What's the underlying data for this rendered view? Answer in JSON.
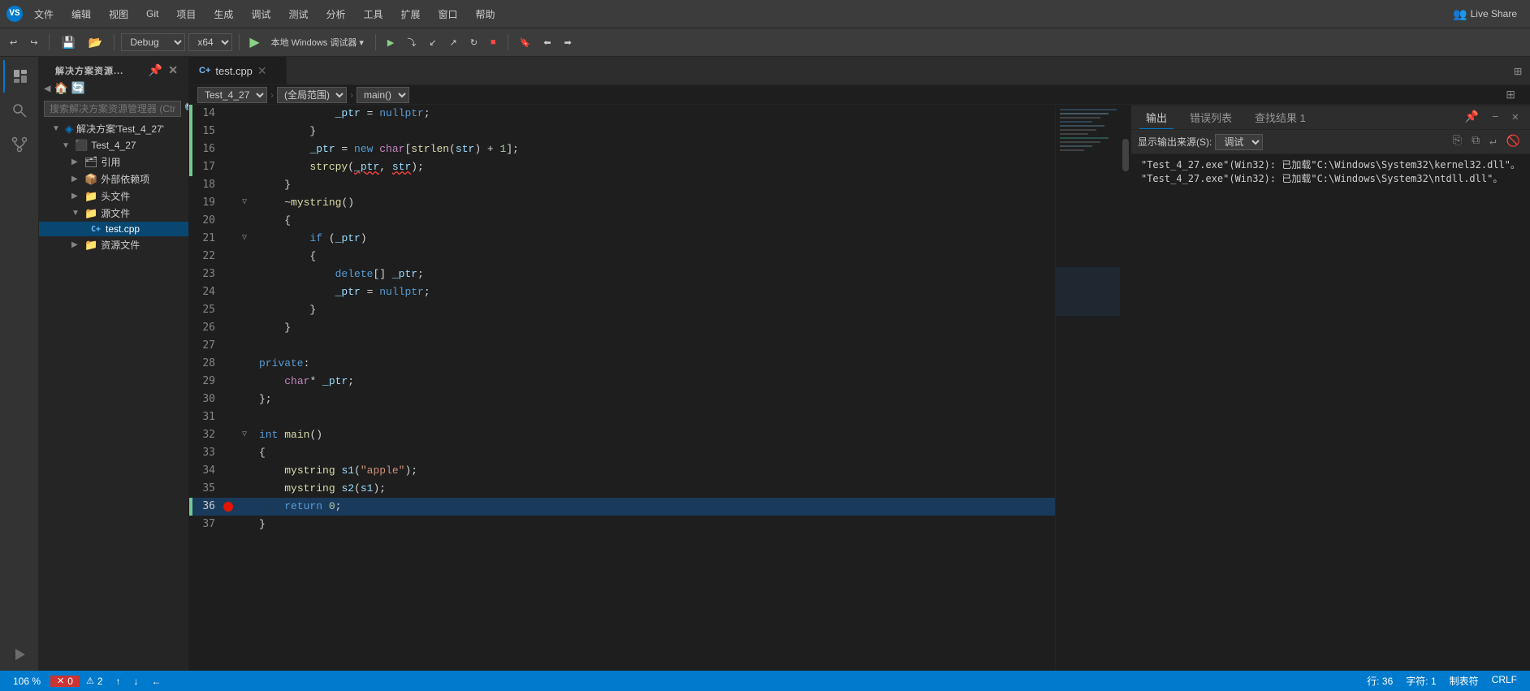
{
  "titlebar": {
    "icon": "VS",
    "menus": [
      "文件",
      "编辑",
      "视图",
      "Git",
      "项目",
      "生成",
      "调试",
      "测试",
      "分析",
      "工具",
      "扩展",
      "窗口",
      "帮助"
    ],
    "live_share_label": "Live Share"
  },
  "toolbar": {
    "undo_label": "↩",
    "redo_label": "↪",
    "config_label": "Debug",
    "arch_label": "x64",
    "play_label": "▶",
    "target_label": "本地 Windows 调试器",
    "run_label": "▶",
    "attach_label": "⏸"
  },
  "sidebar": {
    "title": "解决方案资源...",
    "search_placeholder": "搜索解决方案资源管理器 (Ctrl+;)",
    "tree": [
      {
        "label": "解决方案'Test_4_27'",
        "level": 0,
        "type": "solution",
        "expanded": true
      },
      {
        "label": "Test_4_27",
        "level": 1,
        "type": "project",
        "expanded": true
      },
      {
        "label": "引用",
        "level": 2,
        "type": "folder",
        "expanded": false
      },
      {
        "label": "外部依赖项",
        "level": 2,
        "type": "folder",
        "expanded": false
      },
      {
        "label": "头文件",
        "level": 2,
        "type": "folder",
        "expanded": false
      },
      {
        "label": "源文件",
        "level": 2,
        "type": "folder",
        "expanded": true
      },
      {
        "label": "test.cpp",
        "level": 3,
        "type": "cpp",
        "active": true
      },
      {
        "label": "资源文件",
        "level": 2,
        "type": "folder",
        "expanded": false
      }
    ]
  },
  "tabs": [
    {
      "label": "test.cpp",
      "active": true,
      "modified": false
    }
  ],
  "breadcrumb": {
    "file": "Test_4_27",
    "scope": "(全局范围)",
    "function": "main()"
  },
  "code": {
    "lines": [
      {
        "num": 14,
        "text": "            _ptr = nullptr;",
        "indent": 3,
        "green": true,
        "fold": false
      },
      {
        "num": 15,
        "text": "        }",
        "indent": 2,
        "green": true,
        "fold": false
      },
      {
        "num": 16,
        "text": "        _ptr = new char[strlen(str) + 1];",
        "indent": 2,
        "green": true,
        "fold": false
      },
      {
        "num": 17,
        "text": "        strcpy(_ptr, str);",
        "indent": 2,
        "green": true,
        "fold": false
      },
      {
        "num": 18,
        "text": "    }",
        "indent": 1,
        "green": false,
        "fold": false
      },
      {
        "num": 19,
        "text": "    ~mystring()",
        "indent": 1,
        "green": false,
        "fold": true,
        "folded": false
      },
      {
        "num": 20,
        "text": "    {",
        "indent": 1,
        "green": false,
        "fold": false
      },
      {
        "num": 21,
        "text": "        if (_ptr)",
        "indent": 2,
        "green": false,
        "fold": true,
        "folded": false
      },
      {
        "num": 22,
        "text": "        {",
        "indent": 2,
        "green": false,
        "fold": false
      },
      {
        "num": 23,
        "text": "            delete[] _ptr;",
        "indent": 3,
        "green": false,
        "fold": false
      },
      {
        "num": 24,
        "text": "            _ptr = nullptr;",
        "indent": 3,
        "green": false,
        "fold": false
      },
      {
        "num": 25,
        "text": "        }",
        "indent": 2,
        "green": false,
        "fold": false
      },
      {
        "num": 26,
        "text": "    }",
        "indent": 1,
        "green": false,
        "fold": false
      },
      {
        "num": 27,
        "text": "",
        "indent": 0,
        "green": false,
        "fold": false
      },
      {
        "num": 28,
        "text": "private:",
        "indent": 0,
        "green": false,
        "fold": false
      },
      {
        "num": 29,
        "text": "    char* _ptr;",
        "indent": 1,
        "green": false,
        "fold": false
      },
      {
        "num": 30,
        "text": "};",
        "indent": 0,
        "green": false,
        "fold": false
      },
      {
        "num": 31,
        "text": "",
        "indent": 0,
        "green": false,
        "fold": false
      },
      {
        "num": 32,
        "text": "int main()",
        "indent": 0,
        "green": false,
        "fold": true,
        "folded": false
      },
      {
        "num": 33,
        "text": "{",
        "indent": 0,
        "green": false,
        "fold": false
      },
      {
        "num": 34,
        "text": "    mystring s1(\"apple\");",
        "indent": 1,
        "green": false,
        "fold": false
      },
      {
        "num": 35,
        "text": "    mystring s2(s1);",
        "indent": 1,
        "green": false,
        "fold": false
      },
      {
        "num": 36,
        "text": "    return 0;",
        "indent": 1,
        "green": false,
        "fold": false,
        "current": true,
        "breakpoint": true
      },
      {
        "num": 37,
        "text": "}",
        "indent": 0,
        "green": false,
        "fold": false
      }
    ]
  },
  "statusbar": {
    "errors": "0",
    "warnings": "2",
    "zoom": "106 %",
    "row": "行: 36",
    "col": "字符: 1",
    "tabs": "制表符",
    "encoding": "CRLF"
  },
  "output_panel": {
    "tabs": [
      "输出",
      "错误列表",
      "查找结果 1"
    ],
    "active_tab": "输出",
    "source_label": "显示输出来源(S):",
    "source_value": "调试",
    "content": [
      "\"Test_4_27.exe\"(Win32): 已加载\"C:\\Windows\\System32\\kernel32.dll\"。",
      "\"Test_4_27.exe\"(Win32): 已加载\"C:\\Windows\\System32\\ntdll.dll\"。"
    ]
  },
  "icons": {
    "solution_icon": "◈",
    "project_icon": "⬛",
    "folder_icon": "📁",
    "cpp_icon": "C++",
    "arrow_right": "▶",
    "arrow_down": "▼",
    "close_icon": "✕",
    "add_icon": "+",
    "pin_icon": "📌",
    "split_icon": "⊞",
    "error_icon": "✕",
    "warning_icon": "⚠",
    "live_share_icon": "👥",
    "search_icon": "🔍",
    "up_icon": "↑",
    "down_icon": "↓",
    "left_icon": "←"
  }
}
